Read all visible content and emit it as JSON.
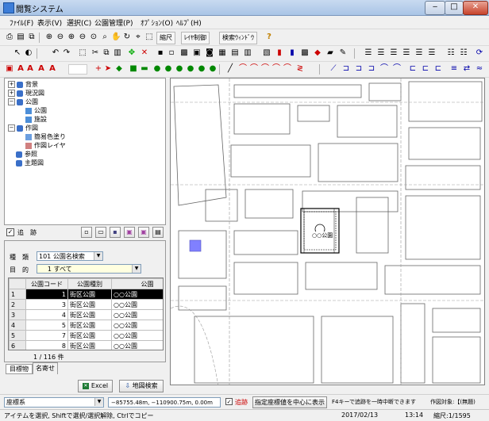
{
  "window": {
    "title": "閲覧システム",
    "min": "‒",
    "max": "□",
    "close": "✕"
  },
  "menu": [
    "ﾌｧｲﾙ(F)",
    "表示(V)",
    "選択(C)",
    "公園管理(P)",
    "ｵﾌﾟｼｮﾝ(O)",
    "ﾍﾙﾌﾟ(H)"
  ],
  "toolbar": {
    "scale": "縮尺",
    "layer_control": "ﾚｲﾔ制御",
    "search_window": "検索ｳｨﾝﾄﾞｳ",
    "help_icon": "?",
    "text_tools": [
      "A",
      "A",
      "A",
      "A"
    ]
  },
  "tree": {
    "nodes": [
      {
        "label": "背景"
      },
      {
        "label": "現況図"
      },
      {
        "label": "公園"
      },
      {
        "label": "公園"
      },
      {
        "label": "施設"
      },
      {
        "label": "作図"
      },
      {
        "label": "簡易色塗り"
      },
      {
        "label": "作図レイヤ"
      },
      {
        "label": "参照"
      },
      {
        "label": "主題図"
      }
    ]
  },
  "trace": {
    "label": "追　跡",
    "checked": true
  },
  "search": {
    "type_label": "種　類",
    "type_code": "101",
    "type_value": "公園名検索",
    "purpose_label": "目　的",
    "purpose_code": "1",
    "purpose_value": "すべて"
  },
  "results": {
    "columns": [
      "",
      "公園コード",
      "公園種別",
      "公園"
    ],
    "rows": [
      [
        "1",
        "1",
        "街区公園",
        "○○公園"
      ],
      [
        "2",
        "3",
        "街区公園",
        "○○公園"
      ],
      [
        "3",
        "4",
        "街区公園",
        "○○公園"
      ],
      [
        "4",
        "5",
        "街区公園",
        "○○公園"
      ],
      [
        "5",
        "7",
        "街区公園",
        "○○公園"
      ],
      [
        "6",
        "8",
        "街区公園",
        "○○公園"
      ]
    ],
    "count": "1 / 116 件"
  },
  "tabs": [
    "目標物",
    "名寄せ"
  ],
  "buttons": {
    "excel": "Excel",
    "map_search": "地図検索"
  },
  "coord_bar": {
    "system": "座標系",
    "coords": "−85755.48m,  −110900.75m,   0.00m",
    "trace_label": "追跡",
    "center_button": "指定座標値を中心に表示",
    "hint": "F4キーで追跡を一時中断できます",
    "target_label": "作図対象:【(無題)"
  },
  "status": {
    "help": "アイテムを選択, Shiftで選択/選択解除, Ctrlでコピー",
    "date": "2017/02/13",
    "time": "13:14",
    "scale": "縮尺:1/1595"
  },
  "map_labels": {
    "park": "○○公園"
  },
  "colors": {
    "highlight": "#8080ff",
    "titlebar": "#b9cfee",
    "selected_row": "#000000"
  }
}
